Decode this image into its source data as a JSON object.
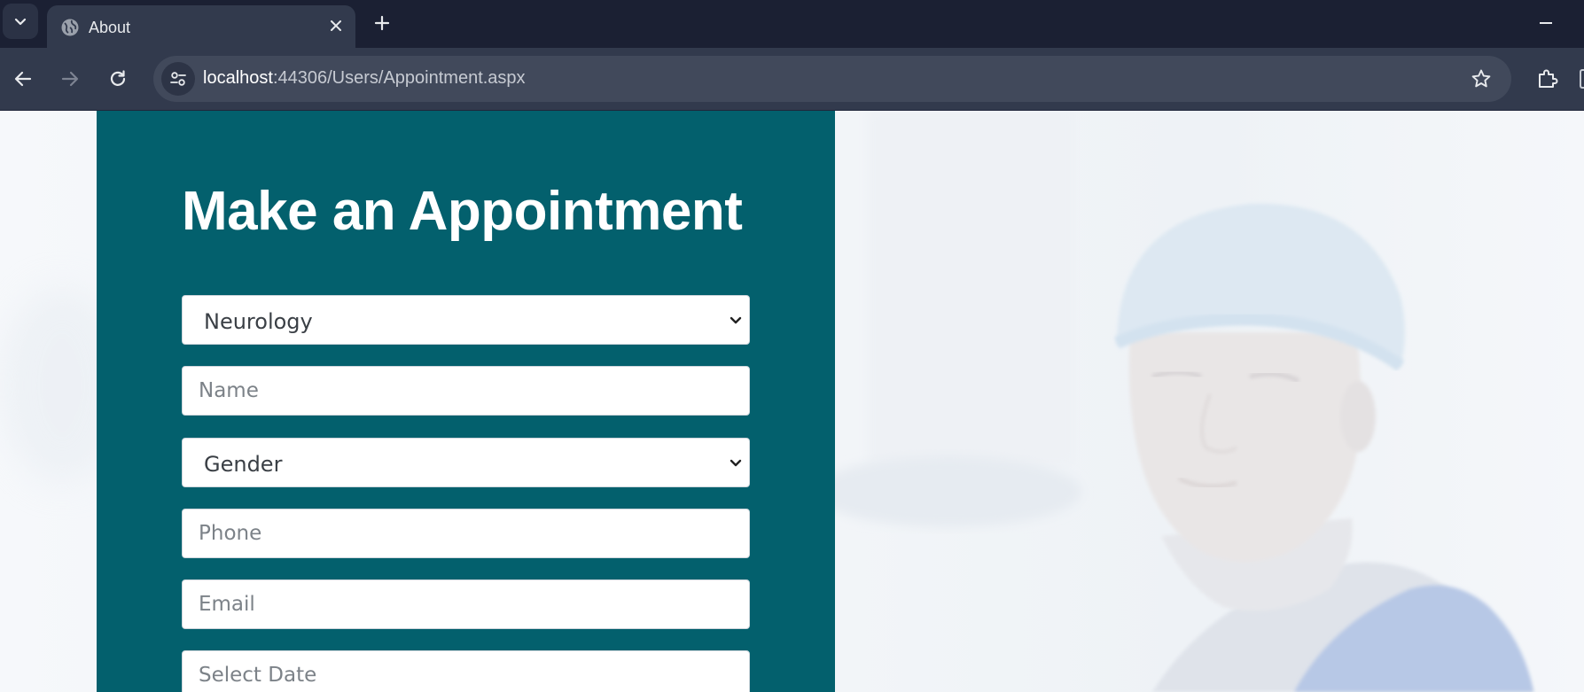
{
  "browser": {
    "tab_title": "About",
    "url_host": "localhost",
    "url_path": ":44306/Users/Appointment.aspx"
  },
  "form": {
    "title": "Make an Appointment",
    "department_selected": "Neurology",
    "name_placeholder": "Name",
    "gender_selected": "Gender",
    "phone_placeholder": "Phone",
    "email_placeholder": "Email",
    "date_placeholder": "Select Date"
  },
  "colors": {
    "form_panel": "#03606d",
    "chrome_dark": "#1b2033",
    "chrome_toolbar": "#323a4d"
  },
  "icons": [
    "tab-search-icon",
    "globe-icon",
    "close-icon",
    "plus-icon",
    "minimize-icon",
    "back-arrow-icon",
    "forward-arrow-icon",
    "reload-icon",
    "site-settings-icon",
    "star-icon",
    "extensions-icon",
    "chevron-down-icon"
  ]
}
